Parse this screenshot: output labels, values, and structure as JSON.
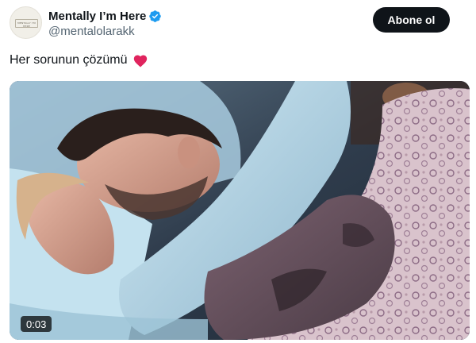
{
  "account": {
    "display_name": "Mentally I’m Here",
    "handle": "@mentalolarakk",
    "avatar_text_line1": "MENTALLY I'M",
    "avatar_text_line2": "HERE"
  },
  "follow_button": {
    "label": "Abone ol"
  },
  "tweet": {
    "text": "Her sorunun çözümü",
    "emoji_icon": "red-heart-icon"
  },
  "media": {
    "duration": "0:03"
  },
  "colors": {
    "verified_blue": "#1d9bf0",
    "heart_red": "#e0245e",
    "button_bg": "#0f1419",
    "handle_gray": "#536471"
  }
}
